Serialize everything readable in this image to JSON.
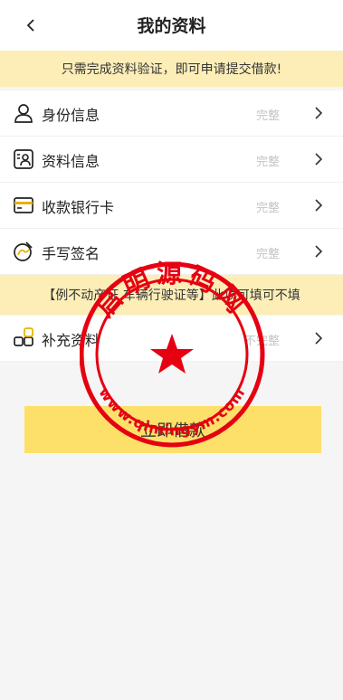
{
  "header": {
    "title": "我的资料"
  },
  "notice": {
    "text": "只需完成资料验证，即可申请提交借款!"
  },
  "items": [
    {
      "label": "身份信息",
      "status": "完整",
      "icon": "person-icon"
    },
    {
      "label": "资料信息",
      "status": "完整",
      "icon": "profile-card-icon"
    },
    {
      "label": "收款银行卡",
      "status": "完整",
      "icon": "bank-card-icon"
    },
    {
      "label": "手写签名",
      "status": "完整",
      "icon": "signature-icon"
    }
  ],
  "optional_note": {
    "text": "【例不动产证 车辆行驶证等】此项可填可不填"
  },
  "extra_item": {
    "label": "补充资料",
    "status": "不完整",
    "icon": "blocks-icon"
  },
  "apply_button": {
    "label": "立即借款"
  },
  "stamp": {
    "top_text": "启明源码网",
    "bottom_text": "www.qimingym.com"
  },
  "colors": {
    "accent": "#fde06a",
    "notice_bg": "#fdeeb8",
    "stamp": "#e60012"
  }
}
